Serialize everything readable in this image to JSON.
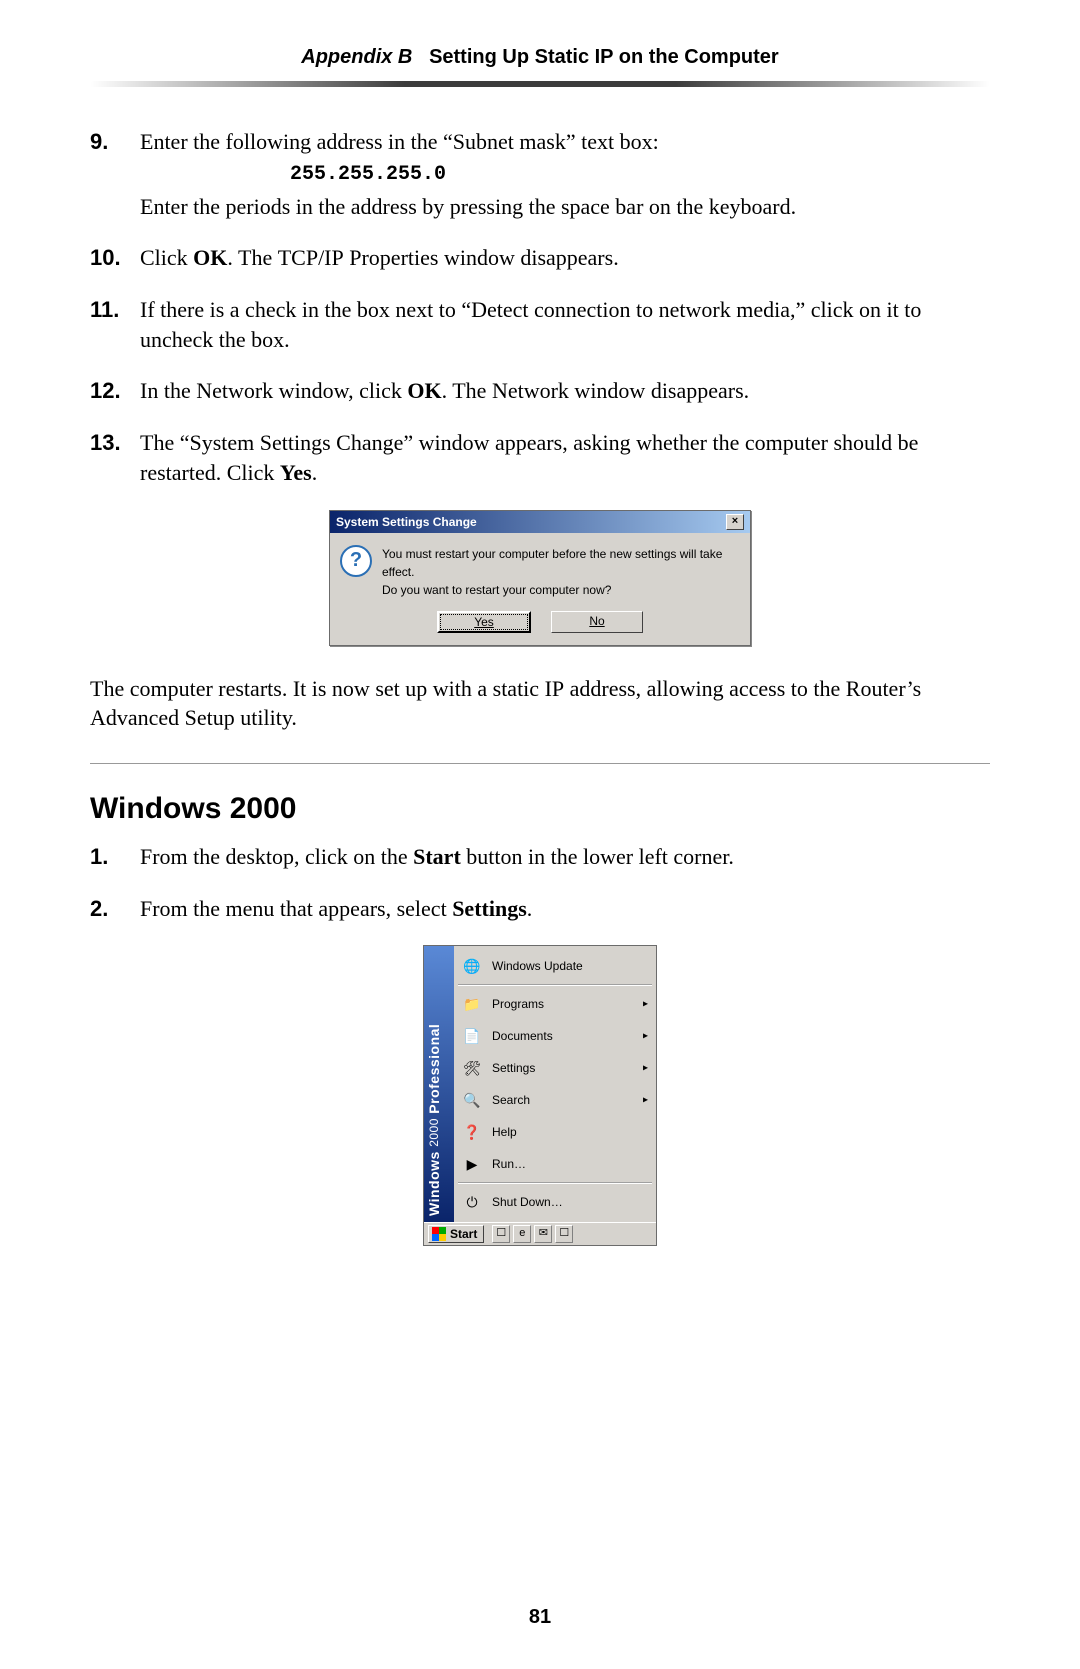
{
  "header": {
    "appendix": "Appendix B",
    "title": "Setting Up Static IP on the Computer"
  },
  "steps_a": [
    {
      "n": "9.",
      "pre": "Enter the following address in the “Subnet mask” text box:",
      "mono": "255.255.255.0",
      "post": "Enter the periods in the address by pressing the space bar on the keyboard."
    },
    {
      "n": "10.",
      "text_a": "Click ",
      "bold_a": "OK",
      "text_b": ". The ",
      "sc": "TCP/IP",
      "text_c": " Properties window disappears."
    },
    {
      "n": "11.",
      "text": "If there is a check in the box next to “Detect connection to network media,” click on it to uncheck the box."
    },
    {
      "n": "12.",
      "text_a": "In the Network window, click ",
      "bold_a": "OK",
      "text_b": ". The Network window disappears."
    },
    {
      "n": "13.",
      "text_a": "The “System Settings Change” window appears, asking whether the computer should be restarted. Click ",
      "bold_a": "Yes",
      "text_b": "."
    }
  ],
  "dialog": {
    "title": "System Settings Change",
    "line1": "You must restart your computer before the new settings will take effect.",
    "line2": "Do you want to restart your computer now?",
    "yes": "Yes",
    "no": "No",
    "close": "×"
  },
  "after_dialog_a": "The computer restarts. It is now set up with a static ",
  "after_dialog_sc": "IP",
  "after_dialog_b": " address, allowing access to the Router’s Advanced Setup utility.",
  "section_heading": "Windows 2000",
  "steps_b": [
    {
      "n": "1.",
      "text_a": "From the desktop, click on the ",
      "bold_a": "Start",
      "text_b": " button in the lower left corner."
    },
    {
      "n": "2.",
      "text_a": "From the menu that appears, select ",
      "bold_a": "Settings",
      "text_b": "."
    }
  ],
  "startmenu": {
    "stripe_a": "Windows",
    "stripe_b": "2000",
    "stripe_c": "Professional",
    "items": [
      {
        "label": "Windows Update",
        "arrow": false,
        "icon": "🌐"
      },
      {
        "label": "Programs",
        "arrow": true,
        "icon": "📁"
      },
      {
        "label": "Documents",
        "arrow": true,
        "icon": "📄"
      },
      {
        "label": "Settings",
        "arrow": true,
        "icon": "🛠"
      },
      {
        "label": "Search",
        "arrow": true,
        "icon": "🔍"
      },
      {
        "label": "Help",
        "arrow": false,
        "icon": "❓"
      },
      {
        "label": "Run…",
        "arrow": false,
        "icon": "▶"
      },
      {
        "label": "Shut Down…",
        "arrow": false,
        "icon": "⏻"
      }
    ],
    "start_label": "Start"
  },
  "page_number": "81"
}
